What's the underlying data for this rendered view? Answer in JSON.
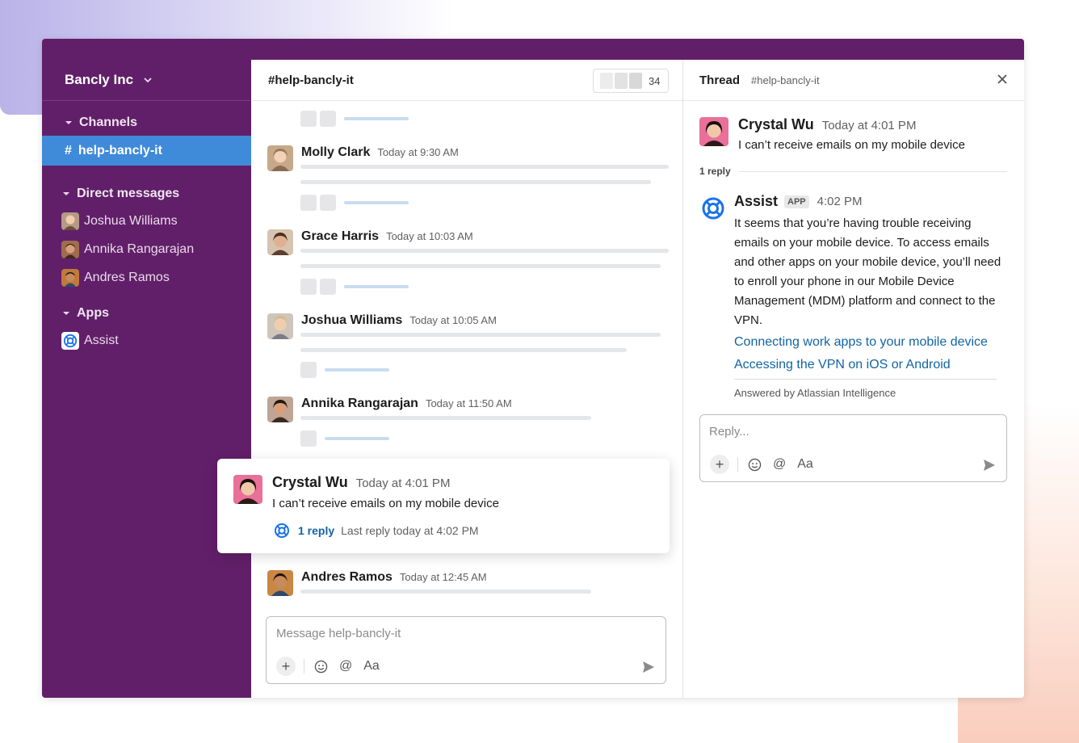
{
  "workspace": {
    "name": "Bancly Inc"
  },
  "sidebar": {
    "channels_title": "Channels",
    "active_channel": {
      "hash": "#",
      "name": "help-bancly-it"
    },
    "dm_title": "Direct messages",
    "dms": [
      {
        "name": "Joshua Williams"
      },
      {
        "name": "Annika Rangarajan"
      },
      {
        "name": "Andres Ramos"
      }
    ],
    "apps_title": "Apps",
    "apps": [
      {
        "name": "Assist"
      }
    ]
  },
  "main": {
    "title": "#help-bancly-it",
    "member_count": "34",
    "messages": [
      {
        "author": "Molly Clark",
        "time": "Today at 9:30 AM"
      },
      {
        "author": "Grace Harris",
        "time": "Today at 10:03 AM"
      },
      {
        "author": "Joshua Williams",
        "time": "Today at 10:05 AM"
      },
      {
        "author": "Annika Rangarajan",
        "time": "Today at 11:50 AM"
      },
      {
        "author": "Andres Ramos",
        "time": "Today at 12:45 AM"
      }
    ],
    "highlight": {
      "author": "Crystal Wu",
      "time": "Today at 4:01 PM",
      "text": "I can’t receive emails on my mobile device",
      "reply_link": "1 reply",
      "reply_meta": "Last reply today at 4:02 PM"
    },
    "composer": {
      "placeholder": "Message help-bancly-it",
      "format_label": "Aa"
    }
  },
  "thread": {
    "title": "Thread",
    "channel": "#help-bancly-it",
    "parent": {
      "author": "Crystal Wu",
      "time": "Today at 4:01 PM",
      "text": "I can’t receive emails on my mobile device"
    },
    "reply_count": "1 reply",
    "assist": {
      "name": "Assist",
      "badge": "APP",
      "time": "4:02 PM",
      "body": "It seems that you’re having trouble receiving emails on your mobile device. To access emails and other apps on your mobile device, you’ll need to enroll your phone in our Mobile Device Management (MDM) platform and connect to the VPN.",
      "link1": "Connecting work apps to your mobile device",
      "link2": "Accessing the VPN on iOS or Android",
      "answered_by": "Answered by Atlassian Intelligence"
    },
    "composer": {
      "placeholder": "Reply...",
      "format_label": "Aa"
    }
  },
  "colors": {
    "sidebar_bg": "#611f69",
    "active_channel_bg": "#3f8ad9",
    "link": "#1264a3",
    "assist_icon": "#1a73e8"
  },
  "icons": [
    "chevron-down-icon",
    "caret-down-icon",
    "hash-icon",
    "plus-icon",
    "emoji-icon",
    "mention-icon",
    "format-icon",
    "send-icon",
    "close-icon",
    "lifebuoy-icon"
  ]
}
